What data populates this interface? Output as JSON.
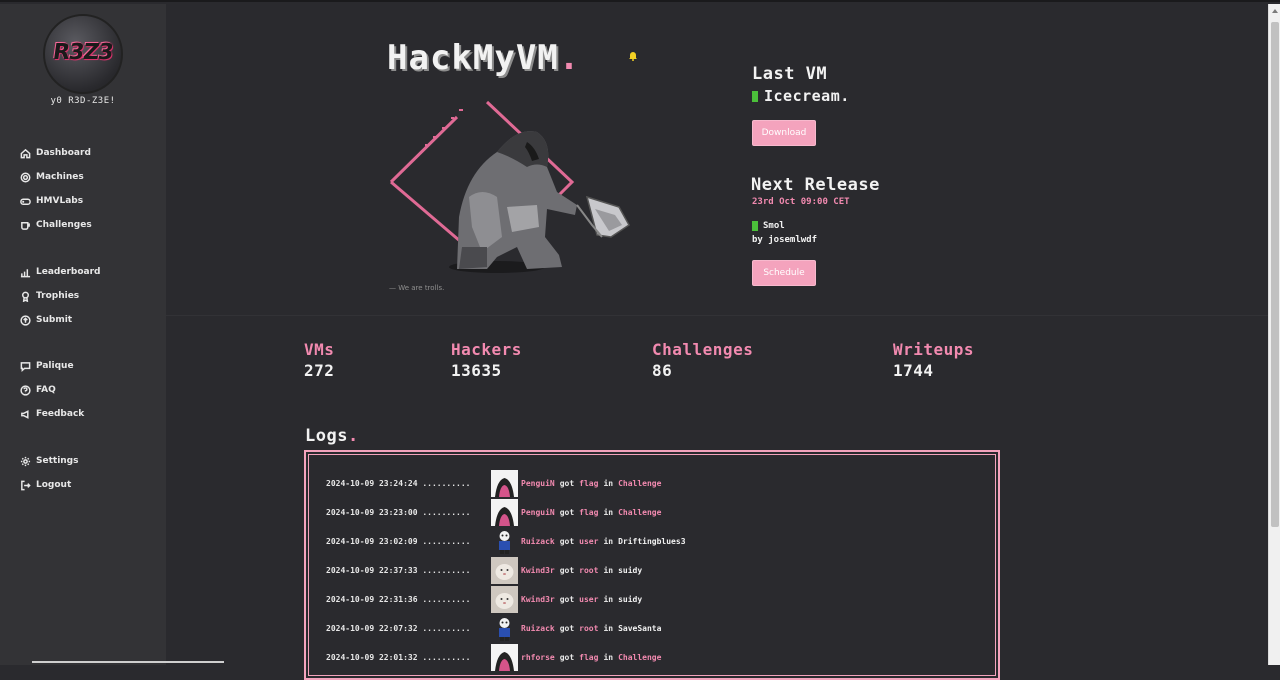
{
  "sidebar": {
    "avatar_text": "R3Z3",
    "greeting": "y0 R3D-Z3E!",
    "group1": [
      {
        "label": "Dashboard",
        "icon": "home-icon"
      },
      {
        "label": "Machines",
        "icon": "gear-icon"
      },
      {
        "label": "HMVLabs",
        "icon": "gamepad-icon"
      },
      {
        "label": "Challenges",
        "icon": "cup-icon"
      }
    ],
    "group2": [
      {
        "label": "Leaderboard",
        "icon": "bar-chart-icon"
      },
      {
        "label": "Trophies",
        "icon": "trophy-icon"
      },
      {
        "label": "Submit",
        "icon": "upload-icon"
      }
    ],
    "group3": [
      {
        "label": "Palique",
        "icon": "chat-icon"
      },
      {
        "label": "FAQ",
        "icon": "question-icon"
      },
      {
        "label": "Feedback",
        "icon": "megaphone-icon"
      }
    ],
    "group4": [
      {
        "label": "Settings",
        "icon": "settings-icon"
      },
      {
        "label": "Logout",
        "icon": "logout-icon"
      }
    ]
  },
  "header": {
    "logo": "HackMyVM",
    "logo_dot": ".",
    "motto": "— We are trolls."
  },
  "last_vm": {
    "title": "Last VM",
    "name": "Icecream.",
    "download_label": "Download"
  },
  "next_release": {
    "title": "Next Release",
    "date": "23rd Oct 09:00 CET",
    "vm": "Smol",
    "by": "by josemlwdf",
    "schedule_label": "Schedule"
  },
  "stats": [
    {
      "label": "VMs",
      "value": "272"
    },
    {
      "label": "Hackers",
      "value": "13635"
    },
    {
      "label": "Challenges",
      "value": "86"
    },
    {
      "label": "Writeups",
      "value": "1744"
    }
  ],
  "logs": {
    "title": "Logs",
    "title_dot": ".",
    "rows": [
      {
        "time": "2024-10-09 23:24:24 ..........",
        "user": "PenguiN",
        "got": "got",
        "type": "flag",
        "in": "in",
        "target": "Challenge"
      },
      {
        "time": "2024-10-09 23:23:00 ..........",
        "user": "PenguiN",
        "got": "got",
        "type": "flag",
        "in": "in",
        "target": "Challenge"
      },
      {
        "time": "2024-10-09 23:02:09 ..........",
        "user": "Ruizack",
        "got": "got",
        "type": "user",
        "in": "in",
        "target": "Driftingblues3"
      },
      {
        "time": "2024-10-09 22:37:33 ..........",
        "user": "Kwind3r",
        "got": "got",
        "type": "root",
        "in": "in",
        "target": "suidy"
      },
      {
        "time": "2024-10-09 22:31:36 ..........",
        "user": "Kwind3r",
        "got": "got",
        "type": "user",
        "in": "in",
        "target": "suidy"
      },
      {
        "time": "2024-10-09 22:07:32 ..........",
        "user": "Ruizack",
        "got": "got",
        "type": "root",
        "in": "in",
        "target": "SaveSanta"
      },
      {
        "time": "2024-10-09 22:01:32 ..........",
        "user": "rhforse",
        "got": "got",
        "type": "flag",
        "in": "in",
        "target": "Challenge"
      }
    ]
  },
  "colors": {
    "accent": "#f28ab0",
    "button": "#f4a3bd",
    "sidebar_bg": "#333336",
    "main_bg": "#2a2a2e",
    "online": "#4bbf3a"
  }
}
